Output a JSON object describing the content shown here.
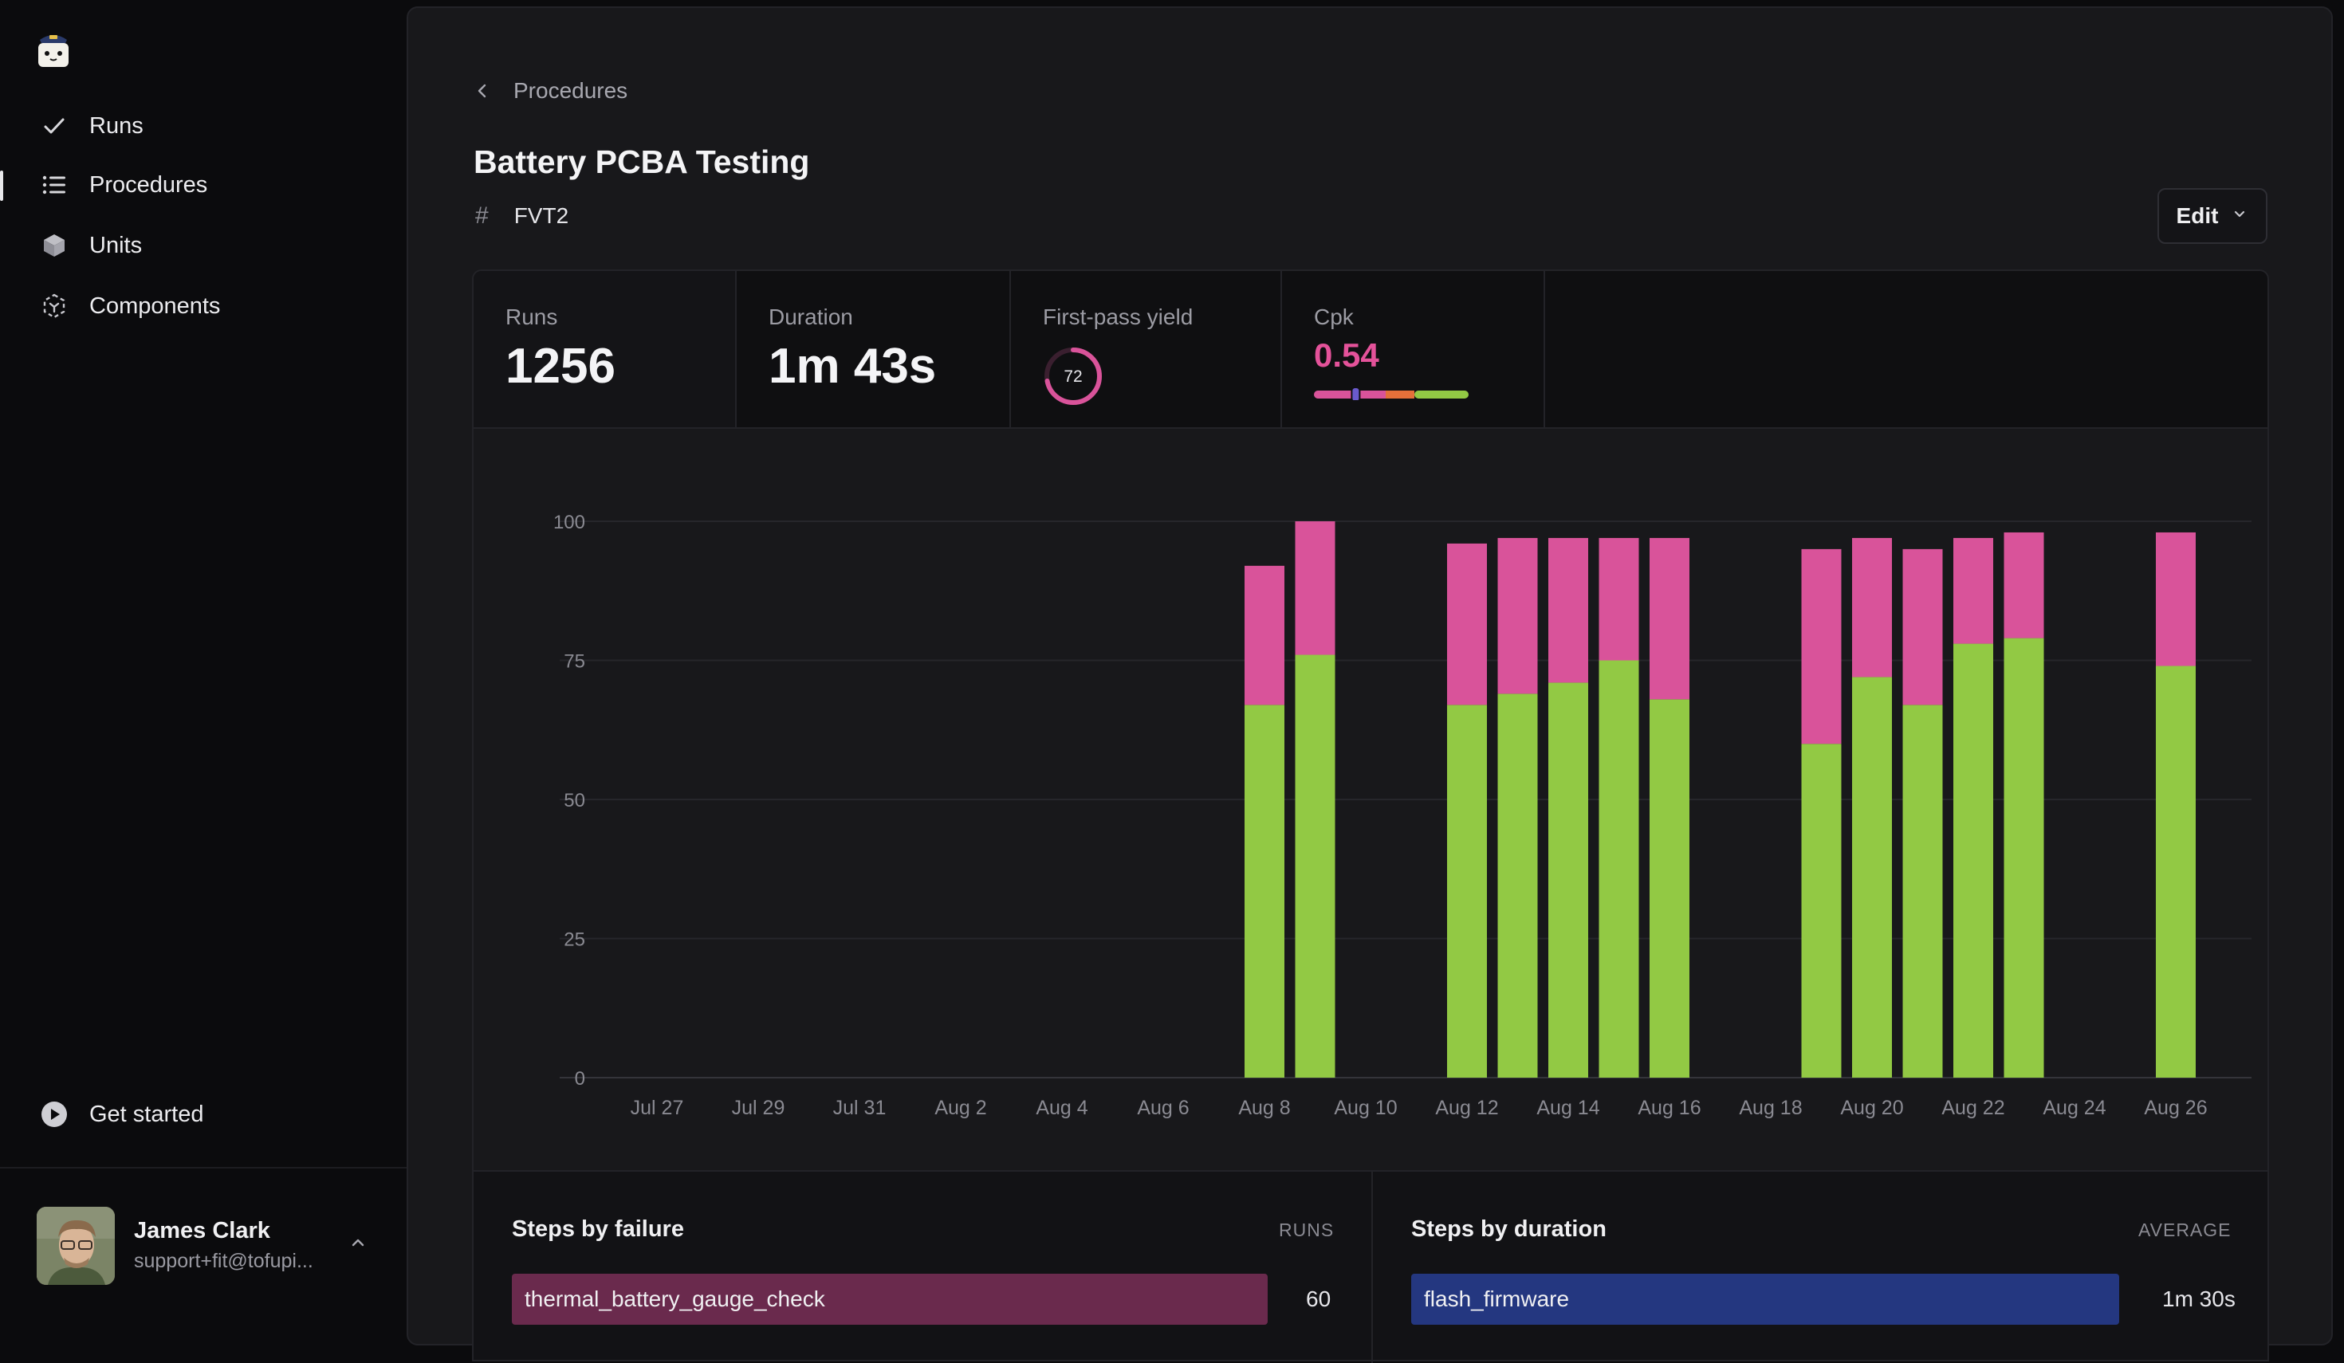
{
  "sidebar": {
    "logo_icon": "tofupilot-logo",
    "items": [
      {
        "label": "Runs",
        "icon": "check-icon",
        "active": false
      },
      {
        "label": "Procedures",
        "icon": "list-icon",
        "active": true
      },
      {
        "label": "Units",
        "icon": "cube-icon",
        "active": false
      },
      {
        "label": "Components",
        "icon": "component-icon",
        "active": false
      }
    ],
    "get_started": {
      "label": "Get started",
      "icon": "play-icon"
    },
    "user": {
      "name": "James Clark",
      "email": "support+fit@tofupi..."
    }
  },
  "header": {
    "breadcrumb": "Procedures",
    "title": "Battery PCBA Testing",
    "tag_icon": "hash-icon",
    "tag": "FVT2",
    "edit_label": "Edit"
  },
  "stats": {
    "runs": {
      "label": "Runs",
      "value": "1256"
    },
    "duration": {
      "label": "Duration",
      "value": "1m 43s"
    },
    "yield": {
      "label": "First-pass yield",
      "value": "72",
      "percent": 72
    },
    "cpk": {
      "label": "Cpk",
      "value": "0.54",
      "marker_fraction": 0.27
    }
  },
  "colors": {
    "pass": "#92c944",
    "fail": "#d9539a",
    "accent": "#4d7ef0",
    "failure_bar": "#6a2a4d",
    "duration_bar": "#243780"
  },
  "chart_data": {
    "type": "bar",
    "stacked": true,
    "x_tick_labels": [
      "Jul 27",
      "Jul 29",
      "Jul 31",
      "Aug 2",
      "Aug 4",
      "Aug 6",
      "Aug 8",
      "Aug 10",
      "Aug 12",
      "Aug 14",
      "Aug 16",
      "Aug 18",
      "Aug 20",
      "Aug 22",
      "Aug 24",
      "Aug 26"
    ],
    "categories": [
      "Jul 27",
      "Jul 28",
      "Jul 29",
      "Jul 30",
      "Jul 31",
      "Aug 1",
      "Aug 2",
      "Aug 3",
      "Aug 4",
      "Aug 5",
      "Aug 6",
      "Aug 7",
      "Aug 8",
      "Aug 9",
      "Aug 10",
      "Aug 11",
      "Aug 12",
      "Aug 13",
      "Aug 14",
      "Aug 15",
      "Aug 16",
      "Aug 17",
      "Aug 18",
      "Aug 19",
      "Aug 20",
      "Aug 21",
      "Aug 22",
      "Aug 23",
      "Aug 24",
      "Aug 25",
      "Aug 26"
    ],
    "series": [
      {
        "values": [
          0,
          0,
          0,
          0,
          0,
          0,
          0,
          0,
          0,
          0,
          0,
          0,
          67,
          76,
          0,
          0,
          67,
          69,
          71,
          75,
          68,
          0,
          0,
          60,
          72,
          67,
          78,
          79,
          0,
          0,
          74
        ]
      },
      {
        "values": [
          0,
          0,
          0,
          0,
          0,
          0,
          0,
          0,
          0,
          0,
          0,
          0,
          25,
          24,
          0,
          0,
          29,
          28,
          26,
          22,
          29,
          0,
          0,
          35,
          25,
          28,
          19,
          19,
          0,
          0,
          24
        ]
      }
    ],
    "yticks": [
      0,
      25,
      50,
      75,
      100
    ],
    "ylim": [
      0,
      100
    ],
    "grid": true
  },
  "steps_by_failure": {
    "title": "Steps by failure",
    "column": "RUNS",
    "rows": [
      {
        "name": "thermal_battery_gauge_check",
        "value": "60"
      }
    ]
  },
  "steps_by_duration": {
    "title": "Steps by duration",
    "column": "AVERAGE",
    "rows": [
      {
        "name": "flash_firmware",
        "value": "1m 30s"
      }
    ]
  }
}
